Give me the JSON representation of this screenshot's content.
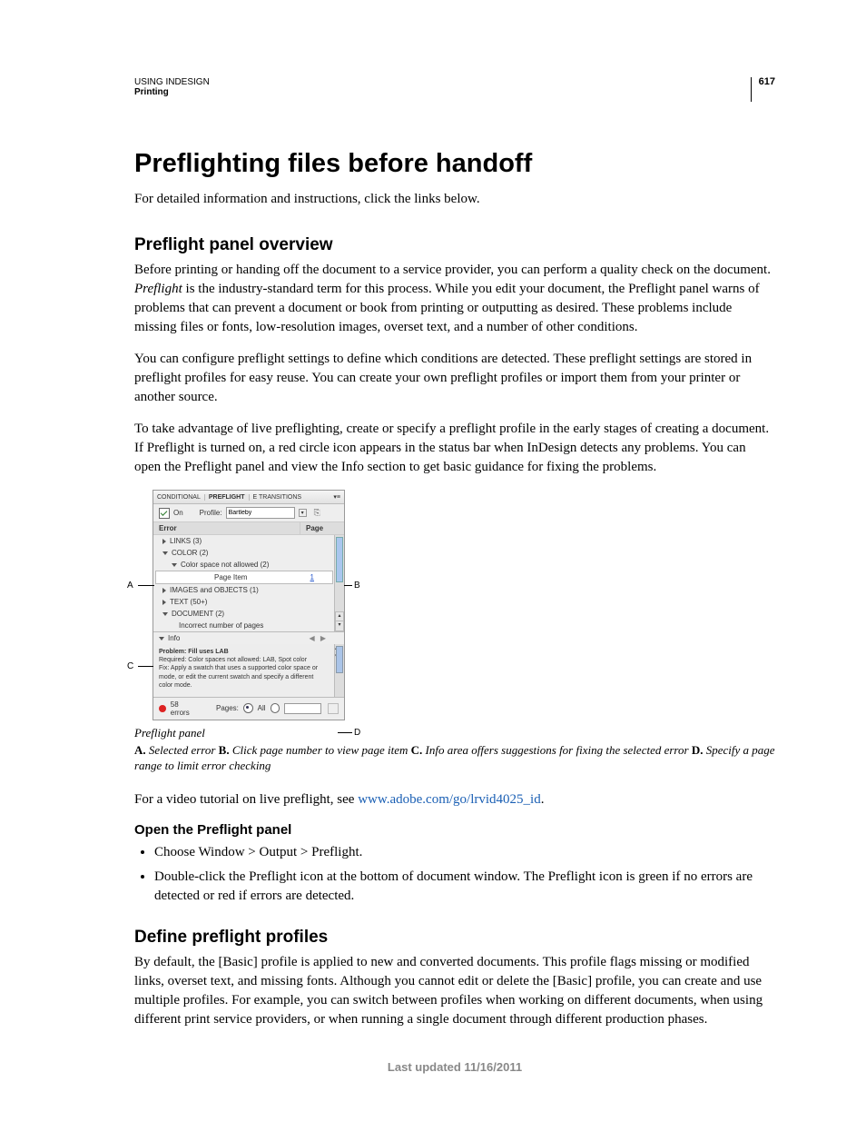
{
  "header": {
    "product": "USING INDESIGN",
    "section": "Printing",
    "page_number": "617"
  },
  "h1": "Preflighting files before handoff",
  "intro": "For detailed information and instructions, click the links below.",
  "h2_overview": "Preflight panel overview",
  "p1a": "Before printing or handing off the document to a service provider, you can perform a quality check on the document. ",
  "p1_term": "Preflight",
  "p1b": " is the industry-standard term for this process. While you edit your document, the Preflight panel warns of problems that can prevent a document or book from printing or outputting as desired. These problems include missing files or fonts, low-resolution images, overset text, and a number of other conditions.",
  "p2": "You can configure preflight settings to define which conditions are detected. These preflight settings are stored in preflight profiles for easy reuse. You can create your own preflight profiles or import them from your printer or another source.",
  "p3": "To take advantage of live preflighting, create or specify a preflight profile in the early stages of creating a document. If Preflight is turned on, a red circle icon appears in the status bar when InDesign detects any problems. You can open the Preflight panel and view the Info section to get basic guidance for fixing the problems.",
  "panel": {
    "tabs": {
      "t1": "CONDITIONAL",
      "t2": "PREFLIGHT",
      "t3": "E TRANSITIONS"
    },
    "on_label": "On",
    "profile_label": "Profile:",
    "profile_value": "Bartleby",
    "col_error": "Error",
    "col_page": "Page",
    "rows": {
      "links": "LINKS (3)",
      "color": "COLOR (2)",
      "color_child": "Color space not allowed (2)",
      "page_item": "Page Item",
      "page_item_page": "1",
      "images": "IMAGES and OBJECTS (1)",
      "text": "TEXT (50+)",
      "doc": "DOCUMENT (2)",
      "doc_child": "Incorrect number of pages"
    },
    "info_label": "Info",
    "info_problem": "Problem: Fill uses LAB",
    "info_required": "Required: Color spaces not allowed: LAB, Spot color",
    "info_fix": "Fix: Apply a swatch that uses a supported color space or mode, or edit the current swatch and specify a different color mode.",
    "status_errors": "58 errors",
    "pages_label": "Pages:",
    "pages_all": "All"
  },
  "callouts": {
    "a": "A",
    "b": "B",
    "c": "C",
    "d": "D"
  },
  "caption": "Preflight panel",
  "legend": {
    "a_label": "A.",
    "a_text": " Selected error  ",
    "b_label": "B.",
    "b_text": " Click page number to view page item  ",
    "c_label": "C.",
    "c_text": " Info area offers suggestions for fixing the selected error  ",
    "d_label": "D.",
    "d_text": " Specify a page range to limit error checking"
  },
  "video_line_a": "For a video tutorial on live preflight, see ",
  "video_link": "www.adobe.com/go/lrvid4025_id",
  "video_line_b": ".",
  "h3_open": "Open the Preflight panel",
  "bullets": {
    "b1": "Choose Window > Output > Preflight.",
    "b2": "Double-click the Preflight icon at the bottom of document window. The Preflight icon is green if no errors are detected or red if errors are detected."
  },
  "h2_define": "Define preflight profiles",
  "p_define": "By default, the [Basic] profile is applied to new and converted documents. This profile flags missing or modified links, overset text, and missing fonts. Although you cannot edit or delete the [Basic] profile, you can create and use multiple profiles. For example, you can switch between profiles when working on different documents, when using different print service providers, or when running a single document through different production phases.",
  "footer": "Last updated 11/16/2011"
}
